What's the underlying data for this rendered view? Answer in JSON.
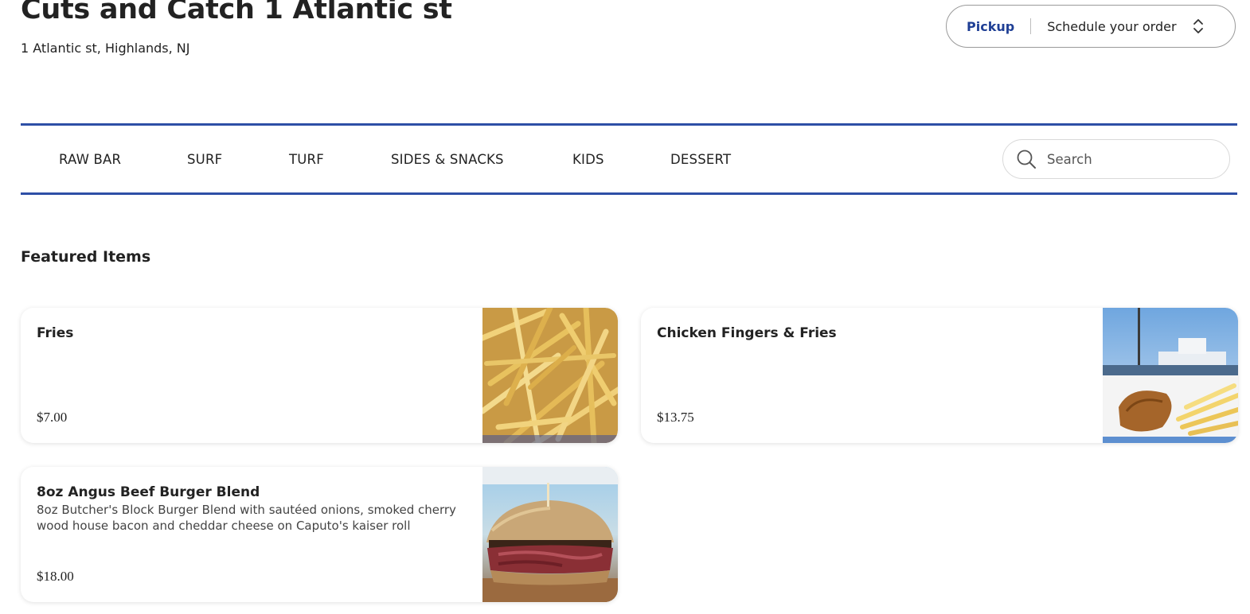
{
  "header": {
    "title": "Cuts and Catch 1 Atlantic st",
    "address": "1 Atlantic st, Highlands, NJ"
  },
  "order_selector": {
    "mode": "Pickup",
    "schedule": "Schedule your order",
    "icon": "chevron-updown-icon"
  },
  "nav": {
    "categories": [
      "RAW BAR",
      "SURF",
      "TURF",
      "SIDES & SNACKS",
      "KIDS",
      "DESSERT"
    ],
    "search_placeholder": "Search"
  },
  "featured": {
    "heading": "Featured Items",
    "items": [
      {
        "name": "Fries",
        "description": "",
        "price": "$7.00",
        "image": "fries-photo"
      },
      {
        "name": "Chicken Fingers & Fries",
        "description": "",
        "price": "$13.75",
        "image": "chicken-fingers-photo"
      },
      {
        "name": "8oz Angus Beef Burger Blend",
        "description": "8oz Butcher's Block Burger Blend with sautéed onions, smoked cherry wood house bacon and cheddar cheese on Caputo's kaiser roll",
        "price": "$18.00",
        "image": "burger-photo"
      }
    ]
  },
  "colors": {
    "accent": "#2e4fa6",
    "pickup_text": "#1f3f95"
  }
}
